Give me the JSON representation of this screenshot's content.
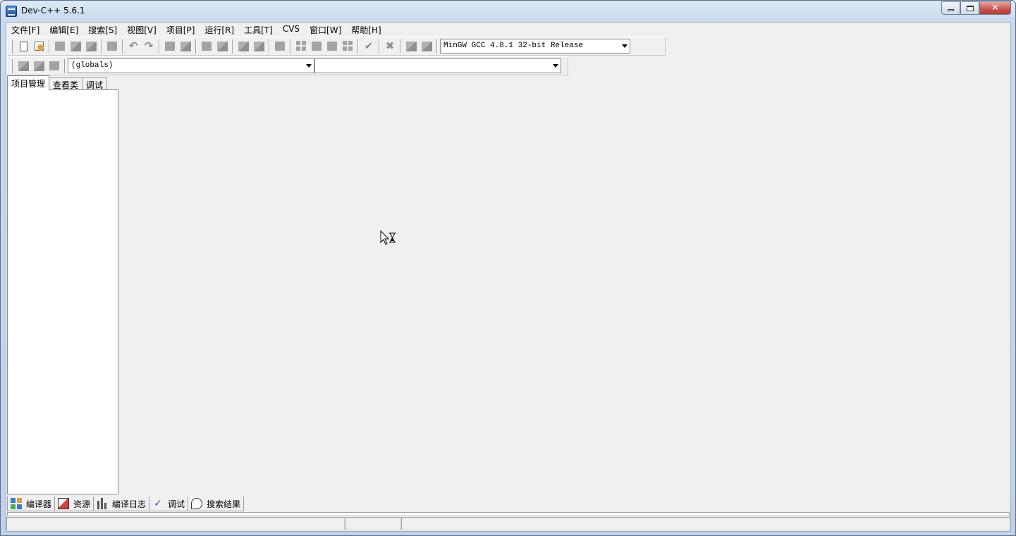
{
  "window": {
    "title": "Dev-C++ 5.6.1",
    "minimize_glyph": "minimize",
    "maximize_glyph": "maximize",
    "close_glyph": "✕"
  },
  "menubar": {
    "items": [
      "文件[F]",
      "编辑[E]",
      "搜索[S]",
      "视图[V]",
      "项目[P]",
      "运行[R]",
      "工具[T]",
      "CVS",
      "窗口[W]",
      "帮助[H]"
    ]
  },
  "toolbar": {
    "compiler_select": "MinGW GCC 4.8.1 32-bit Release",
    "scope_select": "(globals)",
    "member_select": ""
  },
  "left_panel": {
    "tabs": [
      "项目管理",
      "查看类",
      "调试"
    ],
    "active_tab": "项目管理"
  },
  "bottom_panel": {
    "tabs": [
      "编译器",
      "资源",
      "编译日志",
      "调试",
      "搜索结果"
    ]
  },
  "statusbar": {
    "cells": [
      "",
      "",
      ""
    ]
  },
  "icons": {
    "app": "devcpp-icon",
    "cursor": "busy-cursor-icon"
  },
  "colors": {
    "client_bg": "#f0f0f0",
    "pane_bg": "#ffffff",
    "close_button": "#c75050"
  }
}
